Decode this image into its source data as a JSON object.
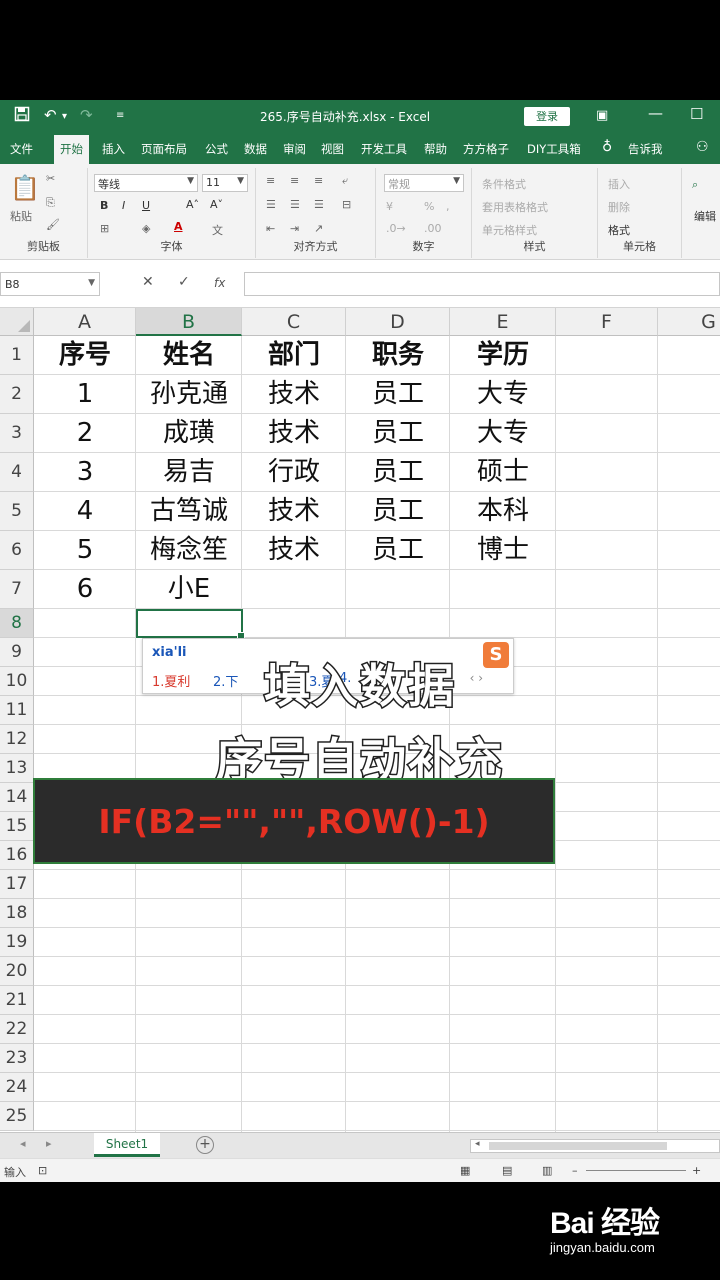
{
  "titlebar": {
    "doc_title": "265.序号自动补充.xlsx  -  Excel",
    "login": "登录",
    "save_icon": "save-icon",
    "undo_icon": "undo-icon",
    "redo_icon": "redo-icon"
  },
  "menu": {
    "tabs": [
      "文件",
      "开始",
      "插入",
      "页面布局",
      "公式",
      "数据",
      "审阅",
      "视图",
      "开发工具",
      "帮助",
      "方方格子",
      "DIY工具箱",
      "告诉我"
    ]
  },
  "ribbon": {
    "font_name": "等线",
    "font_size": "11",
    "number_format": "常规",
    "groups": {
      "clipboard": "剪贴板",
      "font": "字体",
      "alignment": "对齐方式",
      "number": "数字",
      "styles": "样式",
      "cells": "单元格",
      "editing": "编辑"
    },
    "paste": "粘贴",
    "bold": "B",
    "italic": "I",
    "underline": "U",
    "styles_items": [
      "条件格式",
      "套用表格格式",
      "单元格样式"
    ],
    "cells_items": [
      "插入",
      "删除",
      "格式"
    ]
  },
  "formula_bar": {
    "name_box": "B8",
    "cancel": "✕",
    "enter": "✓",
    "fx": "fx"
  },
  "grid": {
    "columns": [
      "A",
      "B",
      "C",
      "D",
      "E",
      "F",
      "G"
    ],
    "rows": [
      "1",
      "2",
      "3",
      "4",
      "5",
      "6",
      "7",
      "8",
      "9",
      "10",
      "11",
      "12",
      "13",
      "14",
      "15",
      "16",
      "17",
      "18",
      "19",
      "20",
      "21",
      "22",
      "23",
      "24",
      "25"
    ],
    "header": [
      "序号",
      "姓名",
      "部门",
      "职务",
      "学历"
    ],
    "data": [
      [
        "1",
        "孙克通",
        "技术",
        "员工",
        "大专"
      ],
      [
        "2",
        "成璜",
        "技术",
        "员工",
        "大专"
      ],
      [
        "3",
        "易吉",
        "行政",
        "员工",
        "硕士"
      ],
      [
        "4",
        "古笃诚",
        "技术",
        "员工",
        "本科"
      ],
      [
        "5",
        "梅念笙",
        "技术",
        "员工",
        "博士"
      ],
      [
        "6",
        "小E",
        "",
        "",
        ""
      ]
    ]
  },
  "ime": {
    "pinyin": "xia'li",
    "candidates": [
      "1.夏利",
      "2.下",
      "3.夏",
      "4."
    ],
    "logo": "S",
    "arrows": "‹  ›"
  },
  "overlay": {
    "line1": "填入数据",
    "line2": "序号自动补充",
    "formula": "IF(B2=\"\",\"\",ROW()-1)"
  },
  "tabs": {
    "sheet": "Sheet1",
    "add": "+"
  },
  "status": {
    "mode": "输入"
  },
  "watermark": {
    "logo": "Bai 经验",
    "url": "jingyan.baidu.com"
  },
  "colors": {
    "excel_green": "#217346",
    "formula_red": "#e53022"
  }
}
